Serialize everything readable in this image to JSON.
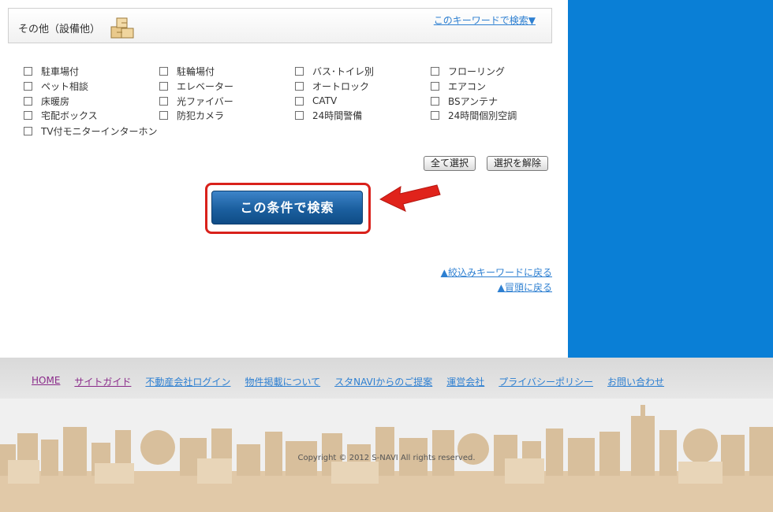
{
  "section": {
    "title": "その他（設備他）",
    "keyword_link": "このキーワードで検索▼"
  },
  "options": [
    {
      "label": "駐車場付"
    },
    {
      "label": "駐輪場付"
    },
    {
      "label": "バス･トイレ別"
    },
    {
      "label": "フローリング"
    },
    {
      "label": "ペット相談"
    },
    {
      "label": "エレベーター"
    },
    {
      "label": "オートロック"
    },
    {
      "label": "エアコン"
    },
    {
      "label": "床暖房"
    },
    {
      "label": "光ファイバー"
    },
    {
      "label": "CATV"
    },
    {
      "label": "BSアンテナ"
    },
    {
      "label": "宅配ボックス"
    },
    {
      "label": "防犯カメラ"
    },
    {
      "label": "24時間警備"
    },
    {
      "label": "24時間個別空調"
    },
    {
      "label": "TV付モニターインターホン"
    }
  ],
  "buttons": {
    "select_all": "全て選択",
    "clear_selection": "選択を解除",
    "search": "この条件で検索"
  },
  "links": {
    "back_keyword": "▲絞込みキーワードに戻る",
    "back_top": "▲冒頭に戻る"
  },
  "footer": {
    "nav": [
      "HOME",
      "サイトガイド",
      "不動産会社ログイン",
      "物件掲載について",
      "スタNAVIからのご提案",
      "運営会社",
      "プライバシーポリシー",
      "お問い合わせ"
    ],
    "copyright": "Copyright © 2012 S-NAVI All rights reserved."
  },
  "colors": {
    "blue_panel": "#0a7fd6",
    "link": "#2d7fd1",
    "highlight_red": "#d9211b"
  }
}
